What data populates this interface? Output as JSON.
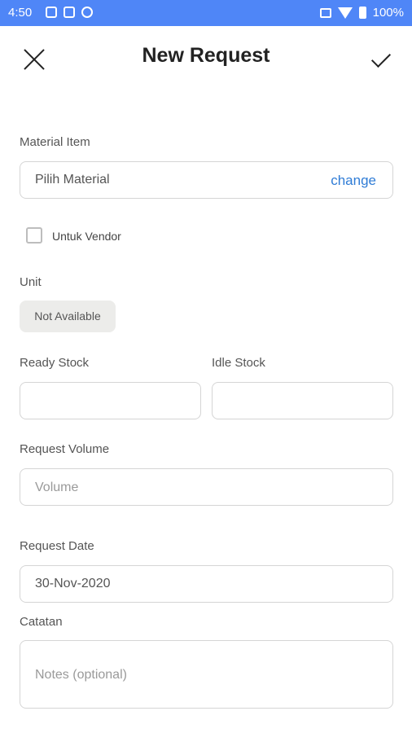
{
  "status": {
    "time": "4:50",
    "battery": "100%"
  },
  "header": {
    "title": "New Request"
  },
  "material": {
    "label": "Material Item",
    "value": "Pilih Material",
    "change": "change"
  },
  "vendor": {
    "label": "Untuk Vendor"
  },
  "unit": {
    "label": "Unit",
    "value": "Not Available"
  },
  "stock": {
    "ready_label": "Ready Stock",
    "idle_label": "Idle Stock"
  },
  "volume": {
    "label": "Request Volume",
    "placeholder": "Volume"
  },
  "date": {
    "label": "Request Date",
    "value": "30-Nov-2020"
  },
  "notes": {
    "label": "Catatan",
    "placeholder": "Notes (optional)"
  }
}
